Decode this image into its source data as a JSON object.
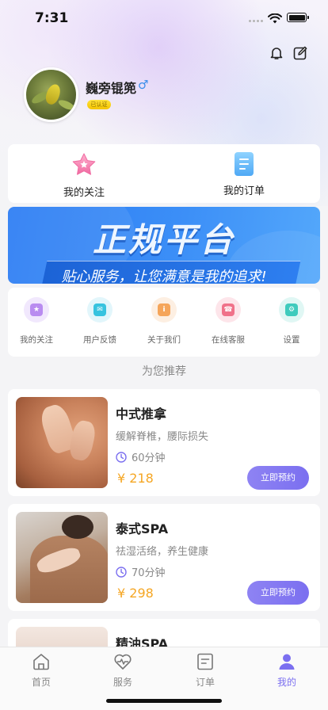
{
  "status_bar": {
    "time": "7:31"
  },
  "profile": {
    "username": "巍旁锟篼",
    "gender_symbol": "♂",
    "badge": "已认证"
  },
  "quick_card": {
    "items": [
      {
        "label": "我的关注",
        "icon": "star-icon"
      },
      {
        "label": "我的订单",
        "icon": "document-icon"
      }
    ]
  },
  "banner": {
    "title": "正规平台",
    "subtitle": "贴心服务，让您满意是我的追求!"
  },
  "menu": {
    "items": [
      {
        "label": "我的关注",
        "icon": "star-icon",
        "color": "#b98cf0"
      },
      {
        "label": "用户反馈",
        "icon": "feedback-icon",
        "color": "#37c3df"
      },
      {
        "label": "关于我们",
        "icon": "about-icon",
        "color": "#f5a55a"
      },
      {
        "label": "在线客服",
        "icon": "service-icon",
        "color": "#f0728a"
      },
      {
        "label": "设置",
        "icon": "gear-icon",
        "color": "#3fcbbd"
      }
    ]
  },
  "section": {
    "title": "为您推荐"
  },
  "services": [
    {
      "name": "中式推拿",
      "desc": "缓解脊椎，腰际损失",
      "duration": "60分钟",
      "price": "¥ 218",
      "button": "立即预约"
    },
    {
      "name": "泰式SPA",
      "desc": "祛湿活络，养生健康",
      "duration": "70分钟",
      "price": "¥ 298",
      "button": "立即预约"
    },
    {
      "name": "精油SPA"
    }
  ],
  "tabs": [
    {
      "label": "首页",
      "icon": "home-icon"
    },
    {
      "label": "服务",
      "icon": "heartbeat-icon"
    },
    {
      "label": "订单",
      "icon": "order-icon"
    },
    {
      "label": "我的",
      "icon": "user-icon",
      "active": true
    }
  ],
  "colors": {
    "accent": "#7b6ff0",
    "price": "#f5a623",
    "banner": "#2a7bf3"
  }
}
